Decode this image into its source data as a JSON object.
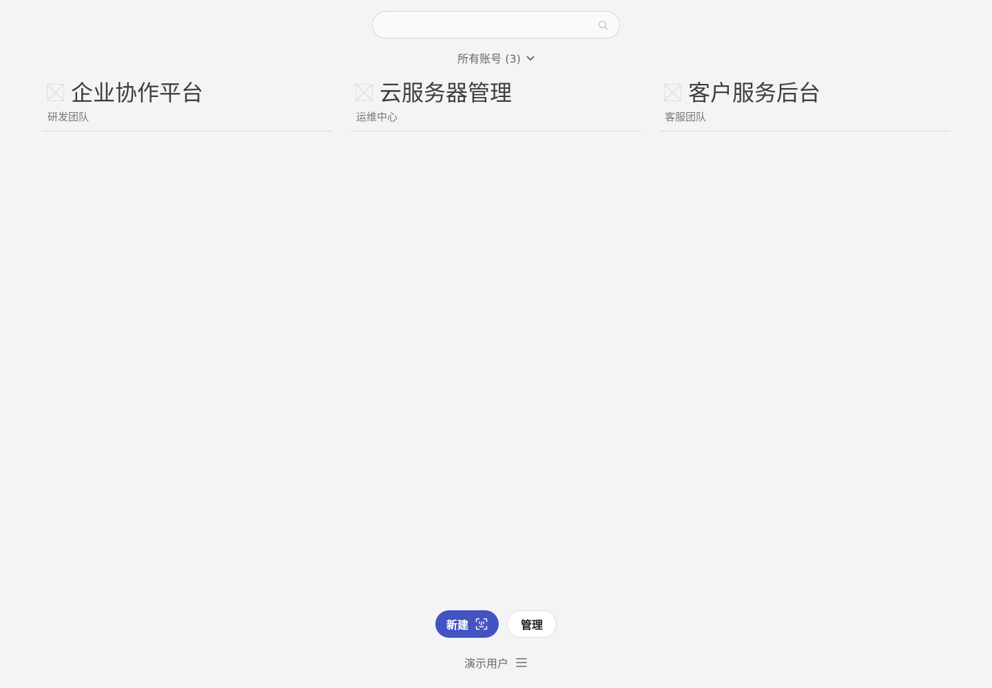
{
  "search": {
    "value": "",
    "placeholder": "",
    "icon": "search-icon"
  },
  "account_filter": {
    "label": "所有账号 (3)",
    "icon": "chevron-down-icon"
  },
  "accounts": [
    {
      "name": "企业协作平台",
      "team": "研发团队",
      "icon": "broken-image-icon"
    },
    {
      "name": "云服务器管理",
      "team": "运维中心",
      "icon": "broken-image-icon"
    },
    {
      "name": "客户服务后台",
      "team": "客服团队",
      "icon": "broken-image-icon"
    }
  ],
  "actions": {
    "new_label": "新建",
    "new_icon": "scan-icon",
    "manage_label": "管理"
  },
  "user": {
    "name": "演示用户",
    "menu_icon": "menu-icon"
  },
  "colors": {
    "background": "#f4f4f4",
    "primary_button": "#4353c1"
  }
}
